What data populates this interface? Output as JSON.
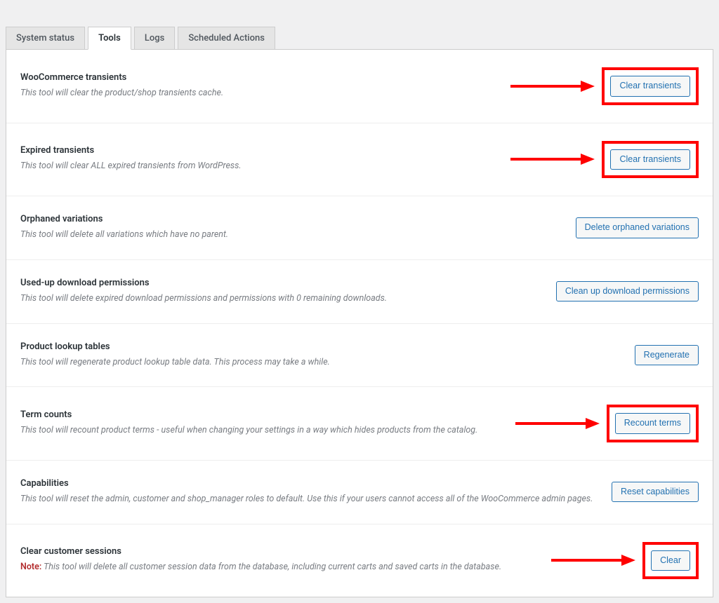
{
  "tabs": [
    {
      "label": "System status",
      "active": false
    },
    {
      "label": "Tools",
      "active": true
    },
    {
      "label": "Logs",
      "active": false
    },
    {
      "label": "Scheduled Actions",
      "active": false
    }
  ],
  "tools": [
    {
      "id": "woocommerce-transients",
      "title": "WooCommerce transients",
      "desc": "This tool will clear the product/shop transients cache.",
      "button": "Clear transients",
      "highlight": true
    },
    {
      "id": "expired-transients",
      "title": "Expired transients",
      "desc": "This tool will clear ALL expired transients from WordPress.",
      "button": "Clear transients",
      "highlight": true
    },
    {
      "id": "orphaned-variations",
      "title": "Orphaned variations",
      "desc": "This tool will delete all variations which have no parent.",
      "button": "Delete orphaned variations",
      "highlight": false
    },
    {
      "id": "used-up-download-permissions",
      "title": "Used-up download permissions",
      "desc": "This tool will delete expired download permissions and permissions with 0 remaining downloads.",
      "button": "Clean up download permissions",
      "highlight": false
    },
    {
      "id": "product-lookup-tables",
      "title": "Product lookup tables",
      "desc": "This tool will regenerate product lookup table data. This process may take a while.",
      "button": "Regenerate",
      "highlight": false
    },
    {
      "id": "term-counts",
      "title": "Term counts",
      "desc": "This tool will recount product terms - useful when changing your settings in a way which hides products from the catalog.",
      "button": "Recount terms",
      "highlight": true
    },
    {
      "id": "capabilities",
      "title": "Capabilities",
      "desc": "This tool will reset the admin, customer and shop_manager roles to default. Use this if your users cannot access all of the WooCommerce admin pages.",
      "button": "Reset capabilities",
      "highlight": false
    },
    {
      "id": "clear-customer-sessions",
      "title": "Clear customer sessions",
      "note": "Note:",
      "desc": "This tool will delete all customer session data from the database, including current carts and saved carts in the database.",
      "button": "Clear",
      "highlight": true
    }
  ]
}
